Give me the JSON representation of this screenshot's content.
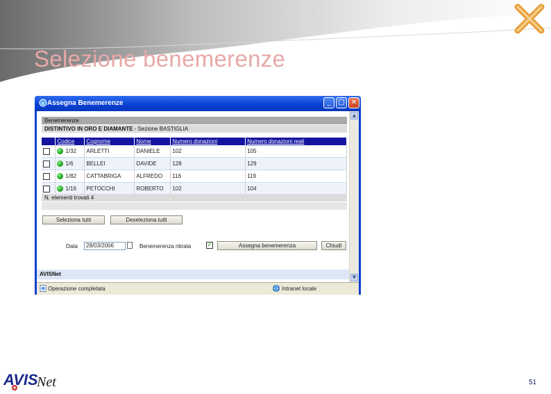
{
  "slide": {
    "title": "Selezione benemerenze",
    "page_number": "51",
    "logo_text": "AVISNet"
  },
  "window": {
    "title": "Assegna Benemerenze",
    "icons": [
      "ie-icon",
      "minimize-icon",
      "maximize-icon",
      "close-icon"
    ]
  },
  "panel": {
    "heading": "Benemerenze",
    "category_bold": "DISTINTIVO IN ORO E DIAMANTE",
    "category_rest": " - Sezione BASTIGLIA"
  },
  "table": {
    "columns": [
      "Codice",
      "Cognome",
      "Nome",
      "Numero donazioni",
      "Numero donazioni reali"
    ],
    "rows": [
      {
        "codice": "1/32",
        "cognome": "ARLETTI",
        "nome": "DANIELE",
        "donazioni": "102",
        "reali": "105"
      },
      {
        "codice": "1/6",
        "cognome": "BELLEI",
        "nome": "DAVIDE",
        "donazioni": "128",
        "reali": "129"
      },
      {
        "codice": "1/82",
        "cognome": "CATTABRIGA",
        "nome": "ALFREDO",
        "donazioni": "116",
        "reali": "119"
      },
      {
        "codice": "1/16",
        "cognome": "PETOCCHI",
        "nome": "ROBERTO",
        "donazioni": "102",
        "reali": "104"
      }
    ],
    "found_label": "N. elementi trovati 4"
  },
  "actions": {
    "select_all": "Seleziona tutti",
    "deselect_all": "Deseleziona tutti",
    "date_label": "Data",
    "date_value": "28/03/2006",
    "ritirata_label": "Benemerenza ritirata",
    "ritirata_checked": true,
    "assign_button": "Assegna benemerenza",
    "close_button": "Chiudi"
  },
  "footer": {
    "app_name": "AVISNet"
  },
  "statusbar": {
    "left_text": "Operazione completata",
    "right_text": "Intranet locale"
  },
  "colors": {
    "title_pink": "#e8a8a8",
    "header_blue": "#1414a0",
    "xp_blue": "#0a3fd0",
    "status_green": "#1aa61a"
  }
}
